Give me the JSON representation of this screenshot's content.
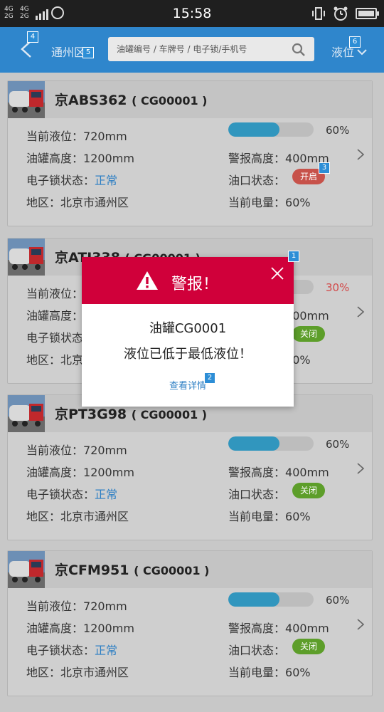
{
  "status_bar": {
    "network1": "4G\n2G",
    "network1_top": "4G",
    "network1_bottom": "2G",
    "network2_top": "4G",
    "network2_bottom": "2G",
    "time": "15:58"
  },
  "header": {
    "region": "通州区",
    "search_placeholder": "油罐编号 / 车牌号 / 电子锁/手机号",
    "level_sort": "液位"
  },
  "labels": {
    "current_level": "当前液位：",
    "tank_height": "油罐高度：",
    "lock_status": "电子锁状态：",
    "area": "地区：",
    "alarm_height": "警报高度：",
    "port_status": "油口状态：",
    "battery": "当前电量："
  },
  "cards": [
    {
      "plate": "京ABS362",
      "code": "( CG00001 )",
      "current_level": "720mm",
      "level_fraction": 0.6,
      "level_pct": "60%",
      "tank_height": "1200mm",
      "alarm_height": "400mm",
      "lock_status": "正常",
      "port_status": "开启",
      "port_state": "open",
      "area": "北京市通州区",
      "battery": "60%"
    },
    {
      "plate": "京ATJ338",
      "code": "( CG00001 )",
      "current_level": "",
      "level_fraction": 0.3,
      "level_pct": "30%",
      "tank_height": "",
      "alarm_height": "400mm",
      "lock_status": "",
      "port_status": "关闭",
      "port_state": "closed",
      "area": "北京",
      "battery": "60%"
    },
    {
      "plate": "京PT3G98",
      "code": "( CG00001 )",
      "current_level": "720mm",
      "level_fraction": 0.6,
      "level_pct": "60%",
      "tank_height": "1200mm",
      "alarm_height": "400mm",
      "lock_status": "正常",
      "port_status": "关闭",
      "port_state": "closed",
      "area": "北京市通州区",
      "battery": "60%"
    },
    {
      "plate": "京CFM951",
      "code": "( CG00001 )",
      "current_level": "720mm",
      "level_fraction": 0.6,
      "level_pct": "60%",
      "tank_height": "1200mm",
      "alarm_height": "400mm",
      "lock_status": "正常",
      "port_status": "关闭",
      "port_state": "closed",
      "area": "北京市通州区",
      "battery": "60%"
    }
  ],
  "modal": {
    "title": "警报！",
    "line1": "油罐CG0001",
    "line2": "液位已低于最低液位！",
    "detail_link": "查看详情"
  },
  "annotations": [
    "1",
    "2",
    "3",
    "4",
    "5",
    "6"
  ],
  "colors": {
    "header_bg": "#2f86cc",
    "alert_red": "#d0003a",
    "level_fill": "#3196be",
    "port_open": "#c7524a",
    "port_closed": "#5d9e2a",
    "link_blue": "#2d7fc4"
  }
}
